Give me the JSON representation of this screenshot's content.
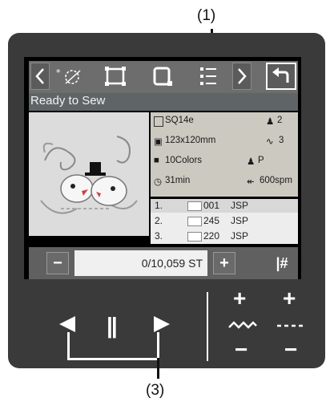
{
  "callouts": {
    "top": "(1)",
    "bottom": "(3)"
  },
  "screen": {
    "status_text": "Ready to Sew",
    "info": {
      "design_name": "SQ14e",
      "size": "123x120mm",
      "colors": "10Colors",
      "time": "31min",
      "hoop_count": "2",
      "stitch_count_icon_value": "3",
      "mode": "P",
      "speed": "600spm"
    },
    "threads": [
      {
        "num": "1.",
        "code": "001",
        "brand": "JSP",
        "color": "#ffffff"
      },
      {
        "num": "2.",
        "code": "245",
        "brand": "JSP",
        "color": "#ffffff"
      },
      {
        "num": "3.",
        "code": "220",
        "brand": "JSP",
        "color": "#ffffff"
      }
    ],
    "counter": "0/10,059 ST",
    "minus_label": "−",
    "plus_label": "+",
    "hash_label": "|#"
  },
  "toolbar_icons": [
    "prev-page-icon",
    "tension-icon",
    "frame-trace-icon",
    "hoop-icon",
    "list-icon",
    "next-page-icon",
    "return-icon"
  ],
  "lower_controls": {
    "plus_left": "+",
    "plus_right": "+",
    "zigzag": "~w~",
    "dashes": "----",
    "minus_left": "−",
    "minus_right": "−",
    "pause": "||"
  },
  "colors": {
    "panel": "#3a3a3a",
    "screen_bg": "#000000",
    "info_bg": "#ccc9c0",
    "accent_white": "#ffffff"
  }
}
